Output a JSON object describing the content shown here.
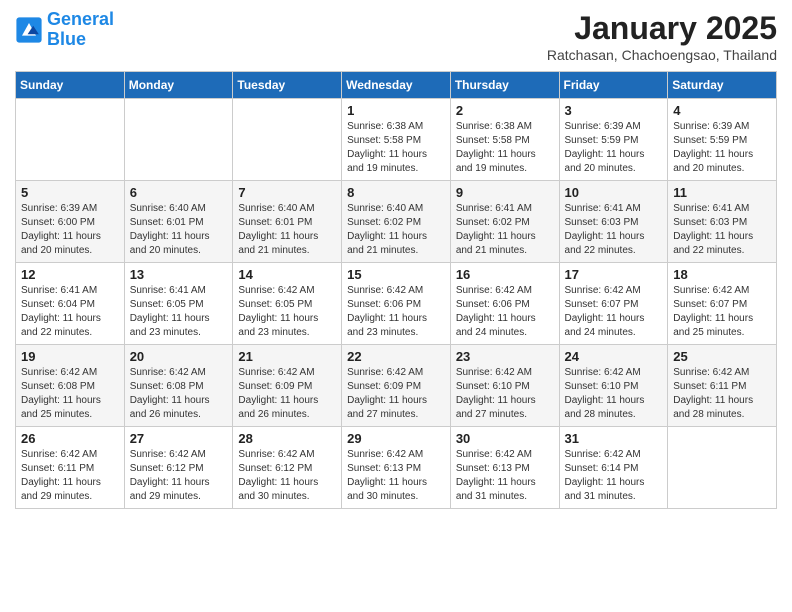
{
  "header": {
    "logo_line1": "General",
    "logo_line2": "Blue",
    "month": "January 2025",
    "location": "Ratchasan, Chachoengsao, Thailand"
  },
  "weekdays": [
    "Sunday",
    "Monday",
    "Tuesday",
    "Wednesday",
    "Thursday",
    "Friday",
    "Saturday"
  ],
  "weeks": [
    [
      {
        "day": "",
        "info": ""
      },
      {
        "day": "",
        "info": ""
      },
      {
        "day": "",
        "info": ""
      },
      {
        "day": "1",
        "info": "Sunrise: 6:38 AM\nSunset: 5:58 PM\nDaylight: 11 hours and 19 minutes."
      },
      {
        "day": "2",
        "info": "Sunrise: 6:38 AM\nSunset: 5:58 PM\nDaylight: 11 hours and 19 minutes."
      },
      {
        "day": "3",
        "info": "Sunrise: 6:39 AM\nSunset: 5:59 PM\nDaylight: 11 hours and 20 minutes."
      },
      {
        "day": "4",
        "info": "Sunrise: 6:39 AM\nSunset: 5:59 PM\nDaylight: 11 hours and 20 minutes."
      }
    ],
    [
      {
        "day": "5",
        "info": "Sunrise: 6:39 AM\nSunset: 6:00 PM\nDaylight: 11 hours and 20 minutes."
      },
      {
        "day": "6",
        "info": "Sunrise: 6:40 AM\nSunset: 6:01 PM\nDaylight: 11 hours and 20 minutes."
      },
      {
        "day": "7",
        "info": "Sunrise: 6:40 AM\nSunset: 6:01 PM\nDaylight: 11 hours and 21 minutes."
      },
      {
        "day": "8",
        "info": "Sunrise: 6:40 AM\nSunset: 6:02 PM\nDaylight: 11 hours and 21 minutes."
      },
      {
        "day": "9",
        "info": "Sunrise: 6:41 AM\nSunset: 6:02 PM\nDaylight: 11 hours and 21 minutes."
      },
      {
        "day": "10",
        "info": "Sunrise: 6:41 AM\nSunset: 6:03 PM\nDaylight: 11 hours and 22 minutes."
      },
      {
        "day": "11",
        "info": "Sunrise: 6:41 AM\nSunset: 6:03 PM\nDaylight: 11 hours and 22 minutes."
      }
    ],
    [
      {
        "day": "12",
        "info": "Sunrise: 6:41 AM\nSunset: 6:04 PM\nDaylight: 11 hours and 22 minutes."
      },
      {
        "day": "13",
        "info": "Sunrise: 6:41 AM\nSunset: 6:05 PM\nDaylight: 11 hours and 23 minutes."
      },
      {
        "day": "14",
        "info": "Sunrise: 6:42 AM\nSunset: 6:05 PM\nDaylight: 11 hours and 23 minutes."
      },
      {
        "day": "15",
        "info": "Sunrise: 6:42 AM\nSunset: 6:06 PM\nDaylight: 11 hours and 23 minutes."
      },
      {
        "day": "16",
        "info": "Sunrise: 6:42 AM\nSunset: 6:06 PM\nDaylight: 11 hours and 24 minutes."
      },
      {
        "day": "17",
        "info": "Sunrise: 6:42 AM\nSunset: 6:07 PM\nDaylight: 11 hours and 24 minutes."
      },
      {
        "day": "18",
        "info": "Sunrise: 6:42 AM\nSunset: 6:07 PM\nDaylight: 11 hours and 25 minutes."
      }
    ],
    [
      {
        "day": "19",
        "info": "Sunrise: 6:42 AM\nSunset: 6:08 PM\nDaylight: 11 hours and 25 minutes."
      },
      {
        "day": "20",
        "info": "Sunrise: 6:42 AM\nSunset: 6:08 PM\nDaylight: 11 hours and 26 minutes."
      },
      {
        "day": "21",
        "info": "Sunrise: 6:42 AM\nSunset: 6:09 PM\nDaylight: 11 hours and 26 minutes."
      },
      {
        "day": "22",
        "info": "Sunrise: 6:42 AM\nSunset: 6:09 PM\nDaylight: 11 hours and 27 minutes."
      },
      {
        "day": "23",
        "info": "Sunrise: 6:42 AM\nSunset: 6:10 PM\nDaylight: 11 hours and 27 minutes."
      },
      {
        "day": "24",
        "info": "Sunrise: 6:42 AM\nSunset: 6:10 PM\nDaylight: 11 hours and 28 minutes."
      },
      {
        "day": "25",
        "info": "Sunrise: 6:42 AM\nSunset: 6:11 PM\nDaylight: 11 hours and 28 minutes."
      }
    ],
    [
      {
        "day": "26",
        "info": "Sunrise: 6:42 AM\nSunset: 6:11 PM\nDaylight: 11 hours and 29 minutes."
      },
      {
        "day": "27",
        "info": "Sunrise: 6:42 AM\nSunset: 6:12 PM\nDaylight: 11 hours and 29 minutes."
      },
      {
        "day": "28",
        "info": "Sunrise: 6:42 AM\nSunset: 6:12 PM\nDaylight: 11 hours and 30 minutes."
      },
      {
        "day": "29",
        "info": "Sunrise: 6:42 AM\nSunset: 6:13 PM\nDaylight: 11 hours and 30 minutes."
      },
      {
        "day": "30",
        "info": "Sunrise: 6:42 AM\nSunset: 6:13 PM\nDaylight: 11 hours and 31 minutes."
      },
      {
        "day": "31",
        "info": "Sunrise: 6:42 AM\nSunset: 6:14 PM\nDaylight: 11 hours and 31 minutes."
      },
      {
        "day": "",
        "info": ""
      }
    ]
  ]
}
